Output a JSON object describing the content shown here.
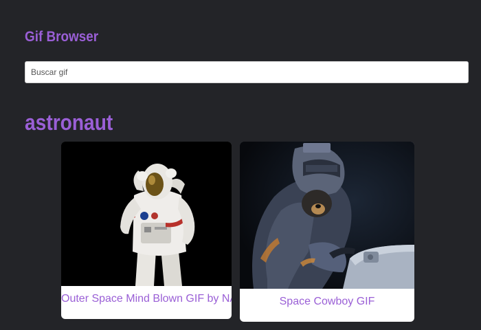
{
  "header": {
    "app_title": "Gif Browser"
  },
  "search": {
    "placeholder": "Buscar gif",
    "value": ""
  },
  "results": {
    "category": "astronaut",
    "gifs": [
      {
        "title": "Outer Space Mind Blown GIF by NASA",
        "image": "astronaut-suit-photo"
      },
      {
        "title": "Space Cowboy GIF",
        "image": "astronaut-bear-illustration"
      }
    ]
  },
  "colors": {
    "background": "#232428",
    "accent": "#9a5fd6",
    "card_background": "#ffffff"
  }
}
